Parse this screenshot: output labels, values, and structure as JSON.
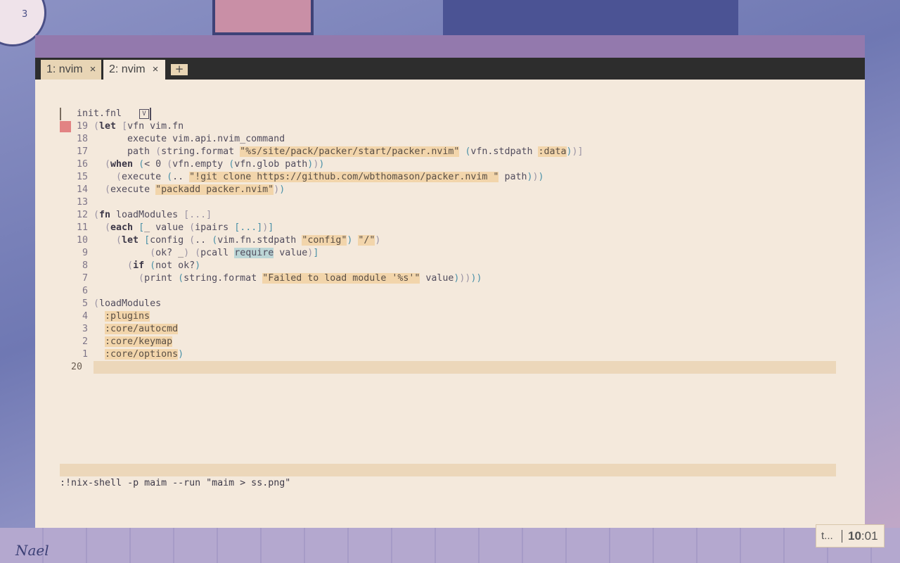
{
  "tabs": [
    {
      "label": "1: nvim",
      "close": "×",
      "active": false
    },
    {
      "label": "2: nvim",
      "close": "×",
      "active": true
    }
  ],
  "new_tab_label": "+",
  "buffer": {
    "name": "init.fnl",
    "icon": "V"
  },
  "lines": [
    {
      "num": "19",
      "sign": true,
      "html": "<span class=\"p\">(</span><span class=\"k\">let</span> <span class=\"p\">[</span>vfn vim.fn"
    },
    {
      "num": "18",
      "html": "      execute vim.api.nvim_command"
    },
    {
      "num": "17",
      "html": "      path <span class=\"p\">(</span>string.format <span class=\"s\">\"%s/site/pack/packer/start/packer.nvim\"</span> <span class=\"b\">(</span>vfn.stdpath <span class=\"s\">:data</span><span class=\"b\">)</span><span class=\"p\">)]</span>"
    },
    {
      "num": "16",
      "html": "  <span class=\"p\">(</span><span class=\"k\">when</span> <span class=\"b\">(</span>&lt; 0 <span class=\"p\">(</span>vfn.empty <span class=\"b\">(</span>vfn.glob path<span class=\"b\">)</span><span class=\"p\">)</span><span class=\"b\">)</span>"
    },
    {
      "num": "15",
      "html": "    <span class=\"p\">(</span>execute <span class=\"b\">(</span>.. <span class=\"s\">\"!git clone https://github.com/wbthomason/packer.nvim \"</span> path<span class=\"b\">)</span><span class=\"p\">)</span><span class=\"b\">)</span>"
    },
    {
      "num": "14",
      "html": "  <span class=\"p\">(</span>execute <span class=\"s\">\"packadd packer.nvim\"</span><span class=\"p\">)</span><span class=\"b\">)</span>"
    },
    {
      "num": "13",
      "html": ""
    },
    {
      "num": "12",
      "html": "<span class=\"p\">(</span><span class=\"k\">fn</span> loadModules <span class=\"p\">[...]</span>"
    },
    {
      "num": "11",
      "html": "  <span class=\"p\">(</span><span class=\"k\">each</span> <span class=\"b\">[</span>_ value <span class=\"p\">(</span>ipairs <span class=\"b\">[...]</span><span class=\"p\">)</span><span class=\"b\">]</span>"
    },
    {
      "num": "10",
      "html": "    <span class=\"p\">(</span><span class=\"k\">let</span> <span class=\"b\">[</span>config <span class=\"p\">(</span>.. <span class=\"b\">(</span>vim.fn.stdpath <span class=\"s\">\"config\"</span><span class=\"b\">)</span> <span class=\"s\">\"/\"</span><span class=\"p\">)</span>"
    },
    {
      "num": "9",
      "html": "          <span class=\"p\">(</span>ok? _<span class=\"p\">)</span> <span class=\"p\">(</span>pcall <span class=\"hl\">require</span> value<span class=\"p\">)</span><span class=\"b\">]</span>"
    },
    {
      "num": "8",
      "html": "      <span class=\"p\">(</span><span class=\"k\">if</span> <span class=\"b\">(</span>not ok?<span class=\"b\">)</span>"
    },
    {
      "num": "7",
      "html": "        <span class=\"p\">(</span>print <span class=\"b\">(</span>string.format <span class=\"s\">\"Failed to load module '%s'\"</span> value<span class=\"b\">)</span><span class=\"p\">))</span><span class=\"b\">))</span>"
    },
    {
      "num": "6",
      "html": ""
    },
    {
      "num": "5",
      "html": "<span class=\"p\">(</span>loadModules"
    },
    {
      "num": "4",
      "html": "  <span class=\"s\">:plugins</span>"
    },
    {
      "num": "3",
      "html": "  <span class=\"s\">:core/autocmd</span>"
    },
    {
      "num": "2",
      "html": "  <span class=\"s\">:core/keymap</span>"
    },
    {
      "num": "1",
      "html": "  <span class=\"s\">:core/options</span><span class=\"b\">)</span>"
    },
    {
      "num": "20",
      "html": "",
      "current": true
    }
  ],
  "command_line": ":!nix-shell -p maim --run \"maim > ss.png\"",
  "tray": {
    "task": "t...",
    "clock_hour": "10",
    "clock_rest": ":01"
  },
  "wallpaper": {
    "signature": "Nael",
    "clock_digit": "3"
  },
  "colors": {
    "title_bar": "#9379ad",
    "tab_bar": "#2d2d2d",
    "editor_bg": "#f4e9dc",
    "cursorline": "#ecd7ba",
    "string_bg": "#f2d5ab",
    "sign_error": "#e28383"
  }
}
